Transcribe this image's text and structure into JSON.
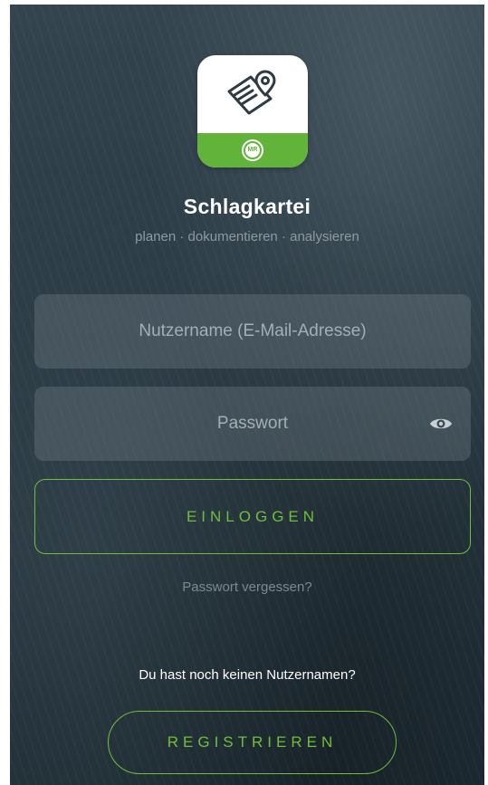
{
  "app": {
    "title": "Schlagkartei",
    "subtitle": "planen · dokumentieren · analysieren",
    "logo_badge_text": "MR",
    "logo_icon": "map-document-pin-icon"
  },
  "login_form": {
    "username_placeholder": "Nutzername (E-Mail-Adresse)",
    "password_placeholder": "Passwort",
    "show_password_icon": "eye-icon",
    "login_label": "EINLOGGEN",
    "forgot_password_label": "Passwort vergessen?"
  },
  "register": {
    "prompt": "Du hast noch keinen Nutzernamen?",
    "button_label": "REGISTRIEREN"
  },
  "colors": {
    "accent_green": "#6fbe3c",
    "logo_green": "#62b33a",
    "background": "#2b3b45"
  }
}
